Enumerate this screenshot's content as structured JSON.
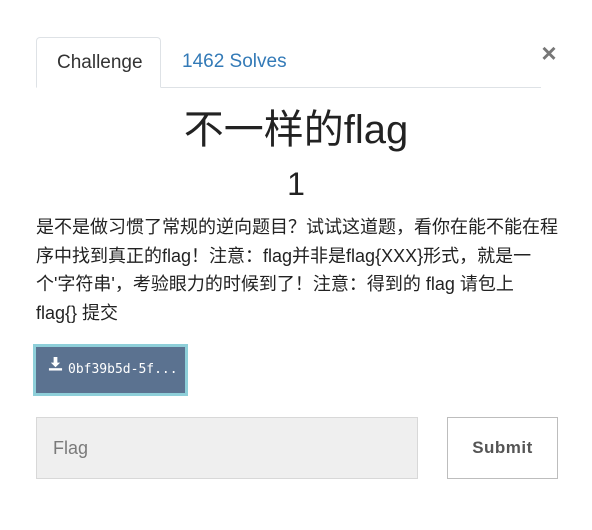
{
  "tabs": {
    "challenge_label": "Challenge",
    "solves_label": "1462 Solves"
  },
  "close_symbol": "×",
  "challenge": {
    "name": "不一样的flag",
    "value": "1",
    "description": "是不是做习惯了常规的逆向题目？试试这道题，看你在能不能在程序中找到真正的flag！注意：flag并非是flag{XXX}形式，就是一个'字符串'，考验眼力的时候到了！注意：得到的 flag 请包上 flag{} 提交"
  },
  "file": {
    "label": "0bf39b5d-5f...",
    "icon": "download-icon"
  },
  "flag_input": {
    "placeholder": "Flag",
    "value": ""
  },
  "submit_label": "Submit",
  "colors": {
    "tab_link": "#337ab7",
    "file_button_bg": "#5b7290",
    "file_button_border": "#8ecfd9",
    "input_bg": "#efefef"
  }
}
